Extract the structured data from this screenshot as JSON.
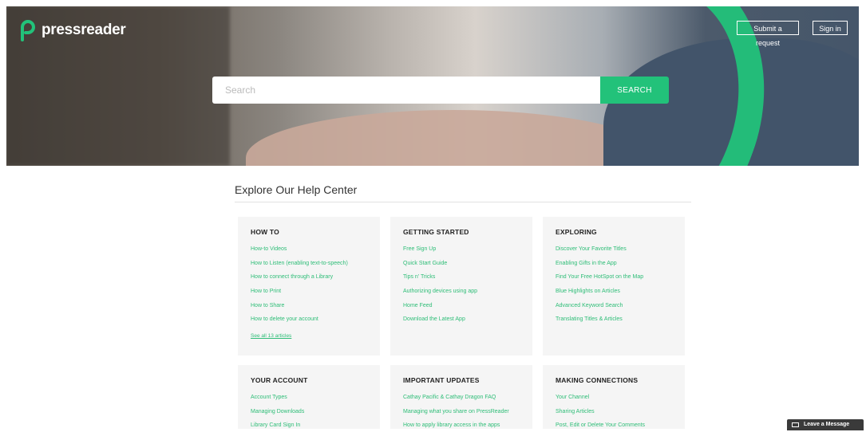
{
  "brand": {
    "name": "pressreader",
    "accent": "#22c27a"
  },
  "header": {
    "submit_request_label": "Submit a request",
    "sign_in_label": "Sign in"
  },
  "search": {
    "placeholder": "Search",
    "button_label": "SEARCH"
  },
  "main": {
    "title": "Explore Our Help Center"
  },
  "categories": [
    {
      "title": "HOW TO",
      "links": [
        "How-to Videos",
        "How to Listen (enabling text-to-speech)",
        "How to connect through a Library",
        "How to Print",
        "How to Share",
        "How to delete your account"
      ],
      "see_all": "See all 13 articles"
    },
    {
      "title": "GETTING STARTED",
      "links": [
        "Free Sign Up",
        "Quick Start Guide",
        "Tips n' Tricks",
        "Authorizing devices using app",
        "Home Feed",
        "Download the Latest App"
      ]
    },
    {
      "title": "EXPLORING",
      "links": [
        "Discover Your Favorite Titles",
        "Enabling Gifts in the App",
        "Find Your Free HotSpot on the Map",
        "Blue Highlights on Articles",
        "Advanced Keyword Search",
        "Translating Titles & Articles"
      ]
    },
    {
      "title": "YOUR ACCOUNT",
      "links": [
        "Account Types",
        "Managing Downloads",
        "Library Card Sign In"
      ]
    },
    {
      "title": "IMPORTANT UPDATES",
      "links": [
        "Cathay Pacific & Cathay Dragon FAQ",
        "Managing what you share on PressReader",
        "How to apply library access in the apps"
      ]
    },
    {
      "title": "MAKING CONNECTIONS",
      "links": [
        "Your Channel",
        "Sharing Articles",
        "Post, Edit or Delete Your Comments"
      ]
    }
  ],
  "chat": {
    "label": "Leave a Message",
    "icon": "envelope-icon"
  }
}
